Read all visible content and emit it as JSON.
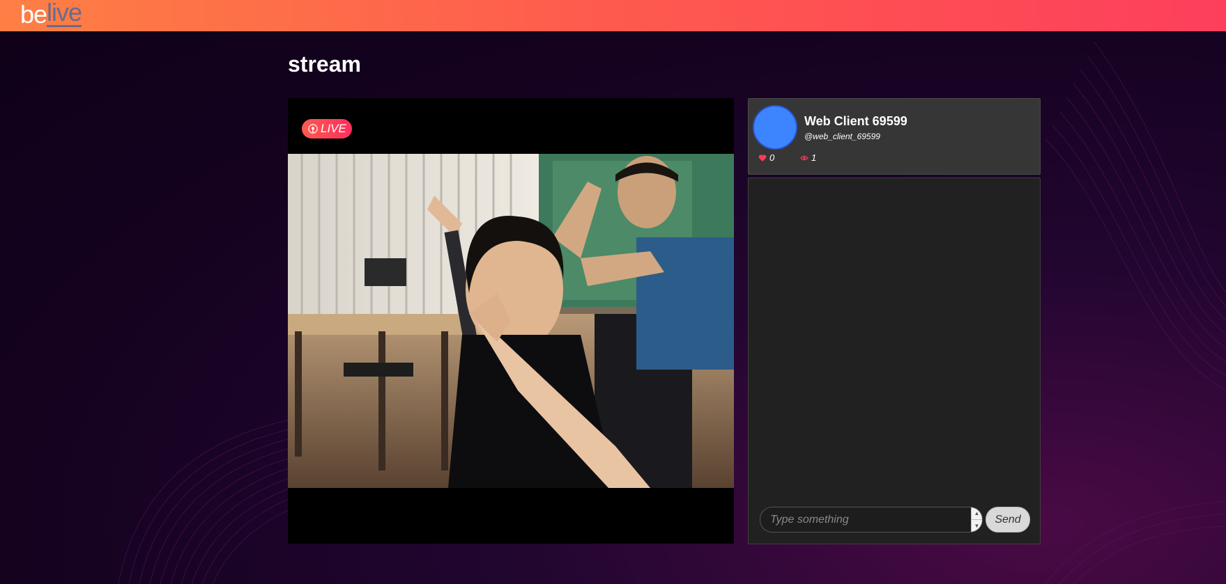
{
  "header": {
    "logo_be": "be",
    "logo_live": "live"
  },
  "page": {
    "title": "stream"
  },
  "player": {
    "live_label": "LIVE"
  },
  "profile": {
    "display_name": "Web Client 69599",
    "handle": "@web_client_69599",
    "likes": "0",
    "views": "1"
  },
  "chat": {
    "placeholder": "Type something",
    "send_label": "Send"
  },
  "colors": {
    "brand_gradient_start": "#fe7f45",
    "brand_gradient_end": "#fd3f5c",
    "avatar": "#3d85fe",
    "like_icon": "#ff3b5c",
    "view_icon": "#ff3b5c"
  }
}
